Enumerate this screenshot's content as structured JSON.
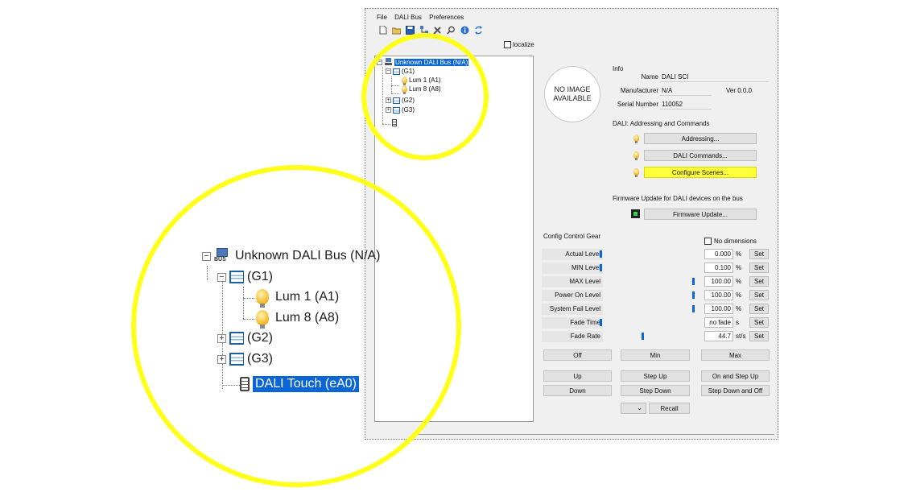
{
  "menu": {
    "file": "File",
    "dali_bus": "DALI Bus",
    "preferences": "Preferences"
  },
  "toolbar": {
    "icons": [
      "new-icon",
      "open-icon",
      "save-icon",
      "network-icon",
      "tools-icon",
      "search-icon",
      "info-icon",
      "refresh-icon"
    ]
  },
  "localize": {
    "label": "localize",
    "checked": false
  },
  "tree": {
    "root": "Unknown DALI Bus (N/A)",
    "g1": "(G1)",
    "lum1": "Lum 1 (A1)",
    "lum8": "Lum 8 (A8)",
    "g2": "(G2)",
    "g3": "(G3)",
    "touch": "DALI Touch (eA0)",
    "expander_minus": "−",
    "expander_plus": "+"
  },
  "device_image": {
    "text": "NO IMAGE AVAILABLE"
  },
  "info": {
    "heading": "Info",
    "name_label": "Name",
    "name_value": "DALI SCI",
    "manufacturer_label": "Manufacturer",
    "manufacturer_value": "N/A",
    "version": "Ver 0.0.0",
    "serial_label": "Serial Number",
    "serial_value": "110052"
  },
  "dali": {
    "heading": "DALI: Addressing and Commands",
    "addressing": "Addressing...",
    "commands": "DALI Commands...",
    "scenes": "Configure Scenes..."
  },
  "firmware": {
    "heading": "Firmware Update for DALI devices on the bus",
    "button": "Firmware Update..."
  },
  "config": {
    "heading": "Config Control Gear",
    "no_dimensions": "No dimensions",
    "set_label": "Set",
    "rows": [
      {
        "label": "Actual Level",
        "value": "0.000",
        "unit": "%",
        "level": 0.0
      },
      {
        "label": "MIN Level",
        "value": "0.100",
        "unit": "%",
        "level": 0.0
      },
      {
        "label": "MAX Level",
        "value": "100.00",
        "unit": "%",
        "level": 1.0
      },
      {
        "label": "Power On Level",
        "value": "100.00",
        "unit": "%",
        "level": 1.0
      },
      {
        "label": "System Fail Level",
        "value": "100.00",
        "unit": "%",
        "level": 1.0
      },
      {
        "label": "Fade Time",
        "value": "no fade",
        "unit": "s",
        "level": 0.0
      },
      {
        "label": "Fade Rate",
        "value": "44.7",
        "unit": "st/s",
        "level": 0.45
      }
    ]
  },
  "commands": {
    "off": "Off",
    "min": "Min",
    "max": "Max",
    "up": "Up",
    "step_up": "Step Up",
    "on_step_up": "On and Step Up",
    "down": "Down",
    "step_down": "Step Down",
    "step_down_off": "Step Down and Off",
    "dropdown_arrow": "⌄",
    "recall": "Recall"
  },
  "colors": {
    "highlight": "#ffff1a",
    "selection": "#0a66d6"
  }
}
